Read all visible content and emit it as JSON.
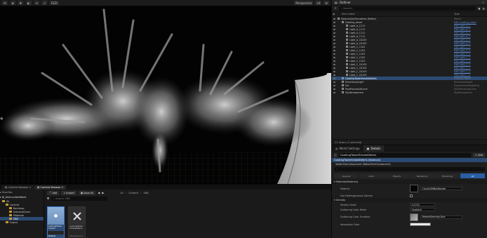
{
  "viewport": {
    "toolbar_left": [
      "☰",
      "◈",
      "✥",
      "◐",
      "⟲",
      "⤢"
    ],
    "title": "ELD-",
    "perspective": "Perspective",
    "lit": "Lit"
  },
  "outliner": {
    "tab_label": "Outliner",
    "search_placeholder": "Search...",
    "col_label": "Item Label",
    "col_type": "Type",
    "rows": [
      {
        "label": "DestructionSimulation (Editor)",
        "type": "World",
        "indent": 0,
        "link": false,
        "sel": false
      },
      {
        "label": "Cooking_tower",
        "type": "Edit Cooking_tower",
        "indent": 1,
        "link": true,
        "sel": false
      },
      {
        "label": "Light_A_C111",
        "type": "Edit Light_A_C",
        "indent": 2,
        "link": true,
        "sel": false
      },
      {
        "label": "Light_A_C111",
        "type": "Edit Light_A_C",
        "indent": 2,
        "link": true,
        "sel": false
      },
      {
        "label": "Light_A_C111",
        "type": "Edit Light_A_C",
        "indent": 2,
        "link": true,
        "sel": false
      },
      {
        "label": "Light_A_C111",
        "type": "Edit Light_A_C",
        "indent": 2,
        "link": true,
        "sel": false
      },
      {
        "label": "Light_A_C0103",
        "type": "Edit Light_A_C",
        "indent": 2,
        "link": true,
        "sel": false
      },
      {
        "label": "Light_A_C0103",
        "type": "Edit Light_A_C",
        "indent": 2,
        "link": true,
        "sel": false
      },
      {
        "label": "Light_C_C101",
        "type": "Edit Light_C_C",
        "indent": 2,
        "link": true,
        "sel": false
      },
      {
        "label": "Light_C_C101",
        "type": "Edit Light_C_C",
        "indent": 2,
        "link": true,
        "sel": false
      },
      {
        "label": "Light_C_C101",
        "type": "Edit Light_C_C",
        "indent": 2,
        "link": true,
        "sel": false
      },
      {
        "label": "Light_C_C101",
        "type": "Edit Light_C_C",
        "indent": 2,
        "link": true,
        "sel": false
      },
      {
        "label": "Light_C_C101",
        "type": "Edit Light_C_C",
        "indent": 2,
        "link": true,
        "sel": false
      },
      {
        "label": "Light_C_C0103",
        "type": "Edit Light_C_C",
        "indent": 2,
        "link": true,
        "sel": false
      },
      {
        "label": "Light_C_C0103",
        "type": "Edit Light_C_C",
        "indent": 2,
        "link": true,
        "sel": false
      },
      {
        "label": "Light_C_C0103",
        "type": "Edit Light_C_C",
        "indent": 2,
        "link": true,
        "sel": false
      },
      {
        "label": "Light_C_C0103",
        "type": "Edit Light_C_C",
        "indent": 2,
        "link": true,
        "sel": false
      },
      {
        "label": "CookingTowerSmokeDebris",
        "type": "Cooking Tower",
        "indent": 1,
        "link": false,
        "sel": true
      },
      {
        "label": "DirectionalLight",
        "type": "DirectionalLight",
        "indent": 1,
        "link": false,
        "sel": false
      },
      {
        "label": "Ext",
        "type": "ExponentialHeightFog",
        "indent": 1,
        "link": false,
        "sel": false
      },
      {
        "label": "PostProcessVolume",
        "type": "PostProcessVolume",
        "indent": 1,
        "link": false,
        "sel": false
      },
      {
        "label": "SkyAtmosphere",
        "type": "SkyAtmosphere",
        "indent": 1,
        "link": false,
        "sel": false
      }
    ],
    "footer": "21 actors (1 selected)"
  },
  "details": {
    "tab_world": "World Settings",
    "tab_details": "Details",
    "actor_name": "CookingTowerSmokeDebris",
    "add_label": "+ Add",
    "components": [
      "CookingTowerSmokeDebris (Instance)",
      "WaterSimComponent (WaterSimComponent)"
    ],
    "filters": [
      "General",
      "Actor",
      "Physics",
      "Rendering",
      "Streaming",
      "All"
    ],
    "section_material": "Material(Material)",
    "prop_material": "Material",
    "material_value": "Cloud1SMBasRender",
    "prop_use_tex": "Use Heterogeneous Volume",
    "section_density": "Density",
    "prop_density_scale": "Density Scale",
    "density_scale_value": "0.2741",
    "prop_scatter_mode": "Scattering Color Mode",
    "scatter_mode_value": "Gradient",
    "prop_scatter_gradient": "Scattering Color Gradient",
    "scatter_gradient_value": "DefaultDensityColor",
    "section_absorption": "Absorption Color"
  },
  "content": {
    "tabs": [
      "Content Browser 1",
      "Content Browser 2"
    ],
    "tree_header": "Favorites",
    "tree_project": "DJ_DestructibleWorld",
    "tree": [
      {
        "label": "All",
        "indent": 0,
        "sel": false
      },
      {
        "label": "Content",
        "indent": 1,
        "sel": false
      },
      {
        "label": "Backdrop",
        "indent": 2,
        "sel": false
      },
      {
        "label": "IndustrialZone",
        "indent": 2,
        "sel": false
      },
      {
        "label": "Materials",
        "indent": 2,
        "sel": false
      },
      {
        "label": "VBD",
        "indent": 2,
        "sel": true
      },
      {
        "label": "Engine",
        "indent": 1,
        "sel": false
      }
    ],
    "add": "Add",
    "import": "Import",
    "save_all": "Save All",
    "path": [
      "All",
      "Content",
      "VBD"
    ],
    "search_placeholder": "Search VBD",
    "assets": [
      {
        "name": "CookingTower Smoke",
        "type": "Material",
        "sel": true
      },
      {
        "name": "CookingTower SmokeDebris",
        "type": "Heterogeneous",
        "sel": false
      }
    ]
  }
}
